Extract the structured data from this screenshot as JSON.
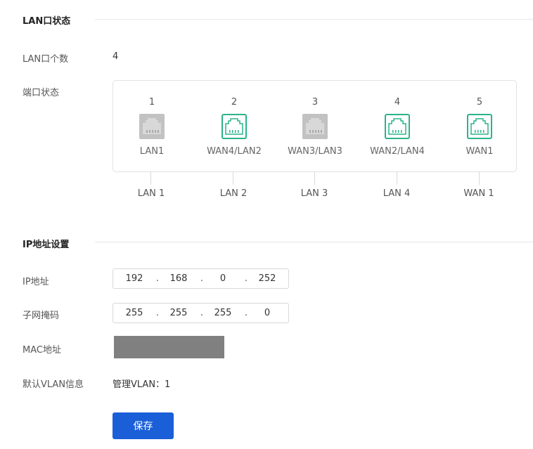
{
  "lan_section": {
    "title": "LAN口状态",
    "count_label": "LAN口个数",
    "count_value": "4",
    "status_label": "端口状态",
    "ports": [
      {
        "num": "1",
        "name": "LAN1",
        "active": false
      },
      {
        "num": "2",
        "name": "WAN4/LAN2",
        "active": true
      },
      {
        "num": "3",
        "name": "WAN3/LAN3",
        "active": false
      },
      {
        "num": "4",
        "name": "WAN2/LAN4",
        "active": true
      },
      {
        "num": "5",
        "name": "WAN1",
        "active": true
      }
    ],
    "port_labels": [
      "LAN 1",
      "LAN 2",
      "LAN 3",
      "LAN 4",
      "WAN 1"
    ]
  },
  "ip_section": {
    "title": "IP地址设置",
    "ip_label": "IP地址",
    "ip": [
      "192",
      "168",
      "0",
      "252"
    ],
    "mask_label": "子网掩码",
    "mask": [
      "255",
      "255",
      "255",
      "0"
    ],
    "mac_label": "MAC地址",
    "vlan_label": "默认VLAN信息",
    "vlan_value": "管理VLAN：1"
  },
  "save_label": "保存",
  "colors": {
    "active_port": "#2bb38a",
    "inactive_port": "#b5b5b5",
    "primary": "#1a5fd8"
  }
}
